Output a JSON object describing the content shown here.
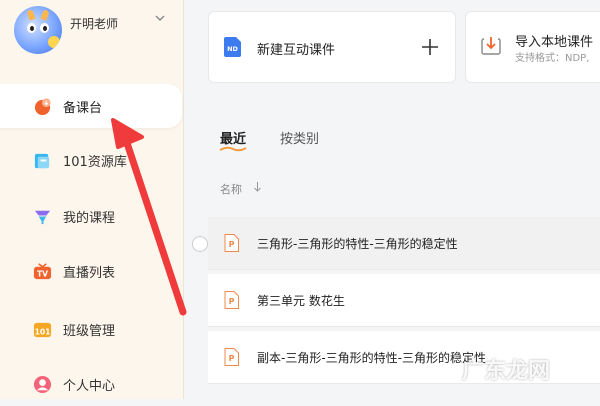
{
  "profile": {
    "name": "开明老师"
  },
  "sidebar": {
    "items": [
      {
        "label": "备课台",
        "icon": "lesson-prep-icon",
        "active": true
      },
      {
        "label": "101资源库",
        "icon": "resource-library-icon"
      },
      {
        "label": "我的课程",
        "icon": "my-courses-icon"
      },
      {
        "label": "直播列表",
        "icon": "live-tv-icon"
      },
      {
        "label": "班级管理",
        "icon": "class-management-icon"
      },
      {
        "label": "个人中心",
        "icon": "user-center-icon"
      }
    ]
  },
  "actions": {
    "new_label": "新建互动课件",
    "new_badge": "ND",
    "import_title": "导入本地课件",
    "import_sub": "支持格式：NDP,"
  },
  "tabs": [
    {
      "label": "最近"
    },
    {
      "label": "按类别"
    }
  ],
  "list": {
    "column_name": "名称",
    "sort_icon": "sort-down-arrow-icon",
    "rows": [
      {
        "name": "三角形-三角形的特性-三角形的稳定性",
        "icon": "ppt-file-icon"
      },
      {
        "name": "第三单元 数花生",
        "icon": "ppt-file-icon"
      },
      {
        "name": "副本-三角形-三角形的特性-三角形的稳定性",
        "icon": "ppt-file-icon"
      }
    ]
  },
  "watermark": "广东龙网",
  "colors": {
    "accent": "#f0632e",
    "arrow": "#ef3b3b",
    "sidebar_bg": "#fdf6ec",
    "tab_underline": "#f39c3d"
  }
}
